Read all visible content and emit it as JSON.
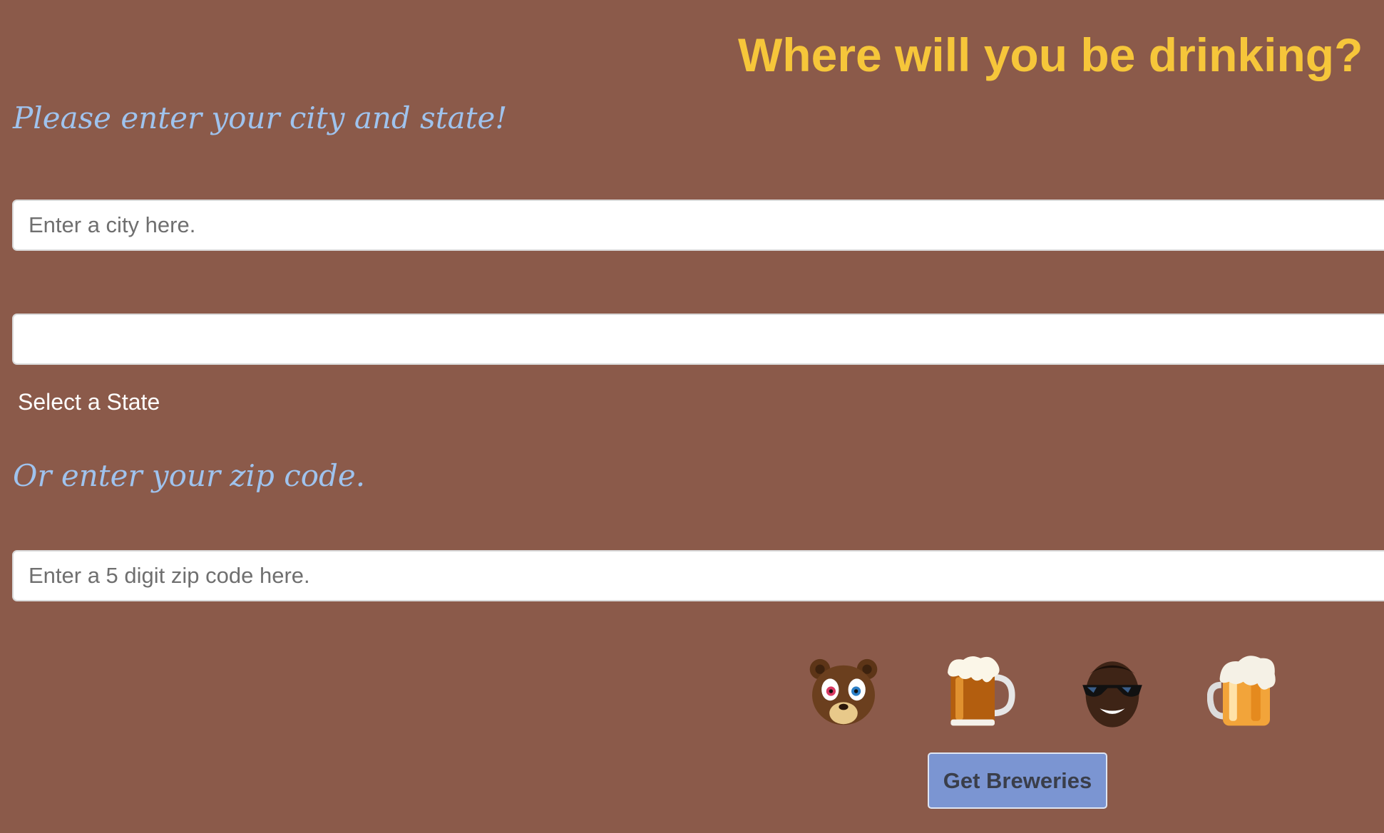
{
  "page": {
    "title": "Where will you be drinking?",
    "city_prompt": "Please enter your city and state!",
    "zip_prompt": "Or enter your zip code."
  },
  "form": {
    "city_placeholder": "Enter a city here.",
    "state_value": "",
    "state_label": "Select a State",
    "zip_placeholder": "Enter a 5 digit zip code here.",
    "submit_label": "Get Breweries"
  },
  "decorations": [
    {
      "icon": "bear-mascot-icon"
    },
    {
      "icon": "beer-mug-icon"
    },
    {
      "icon": "sunglasses-face-icon"
    },
    {
      "icon": "foamy-beer-mug-icon"
    }
  ],
  "colors": {
    "background": "#8b5a4a",
    "title": "#f6c63a",
    "prompt": "#9fc3ee",
    "button": "#7b95d2"
  }
}
